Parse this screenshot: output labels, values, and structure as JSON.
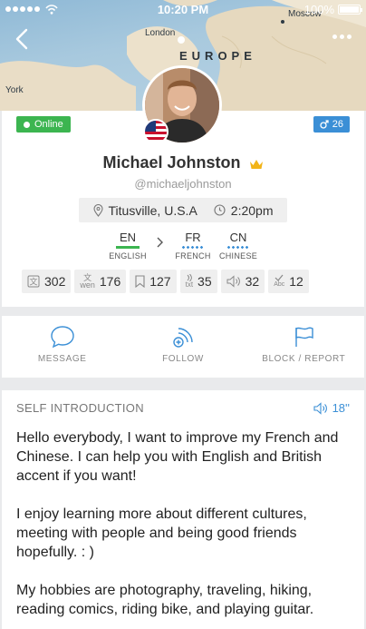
{
  "status_bar": {
    "time": "10:20 PM",
    "battery": "100%"
  },
  "map": {
    "cities": {
      "london": "London",
      "moscow": "Moscow",
      "york": "York"
    },
    "region": "EUROPE"
  },
  "profile": {
    "online_label": "Online",
    "gender_count": "26",
    "name": "Michael Johnston",
    "handle": "@michaeljohnston",
    "location": "Titusville, U.S.A",
    "local_time": "2:20pm",
    "native_language": {
      "code": "EN",
      "name": "ENGLISH"
    },
    "learning_languages": [
      {
        "code": "FR",
        "name": "FRENCH"
      },
      {
        "code": "CN",
        "name": "CHINESE"
      }
    ],
    "stats": {
      "translations": "302",
      "transliterations": "176",
      "bookmarks": "127",
      "text_to_speech": "35",
      "voice": "32",
      "corrections": "12"
    },
    "stat_icon_text": {
      "wen_char": "文",
      "wen": "wen",
      "txt": "txt",
      "abc": "Abc"
    }
  },
  "actions": {
    "message": "MESSAGE",
    "follow": "FOLLOW",
    "block_report": "BLOCK / REPORT"
  },
  "intro": {
    "heading": "SELF INTRODUCTION",
    "audio_duration": "18''",
    "paragraphs": [
      "Hello everybody, I want to improve my French and Chinese. I can help you with English and British accent if you want!",
      "I enjoy learning more about different cultures, meeting with people and being good friends hopefully. : )",
      "My hobbies are photography, traveling, hiking, reading comics, riding bike, and playing guitar."
    ]
  },
  "colors": {
    "online": "#3cb550",
    "accent_blue": "#3b8fd6",
    "crown": "#f2b418"
  }
}
